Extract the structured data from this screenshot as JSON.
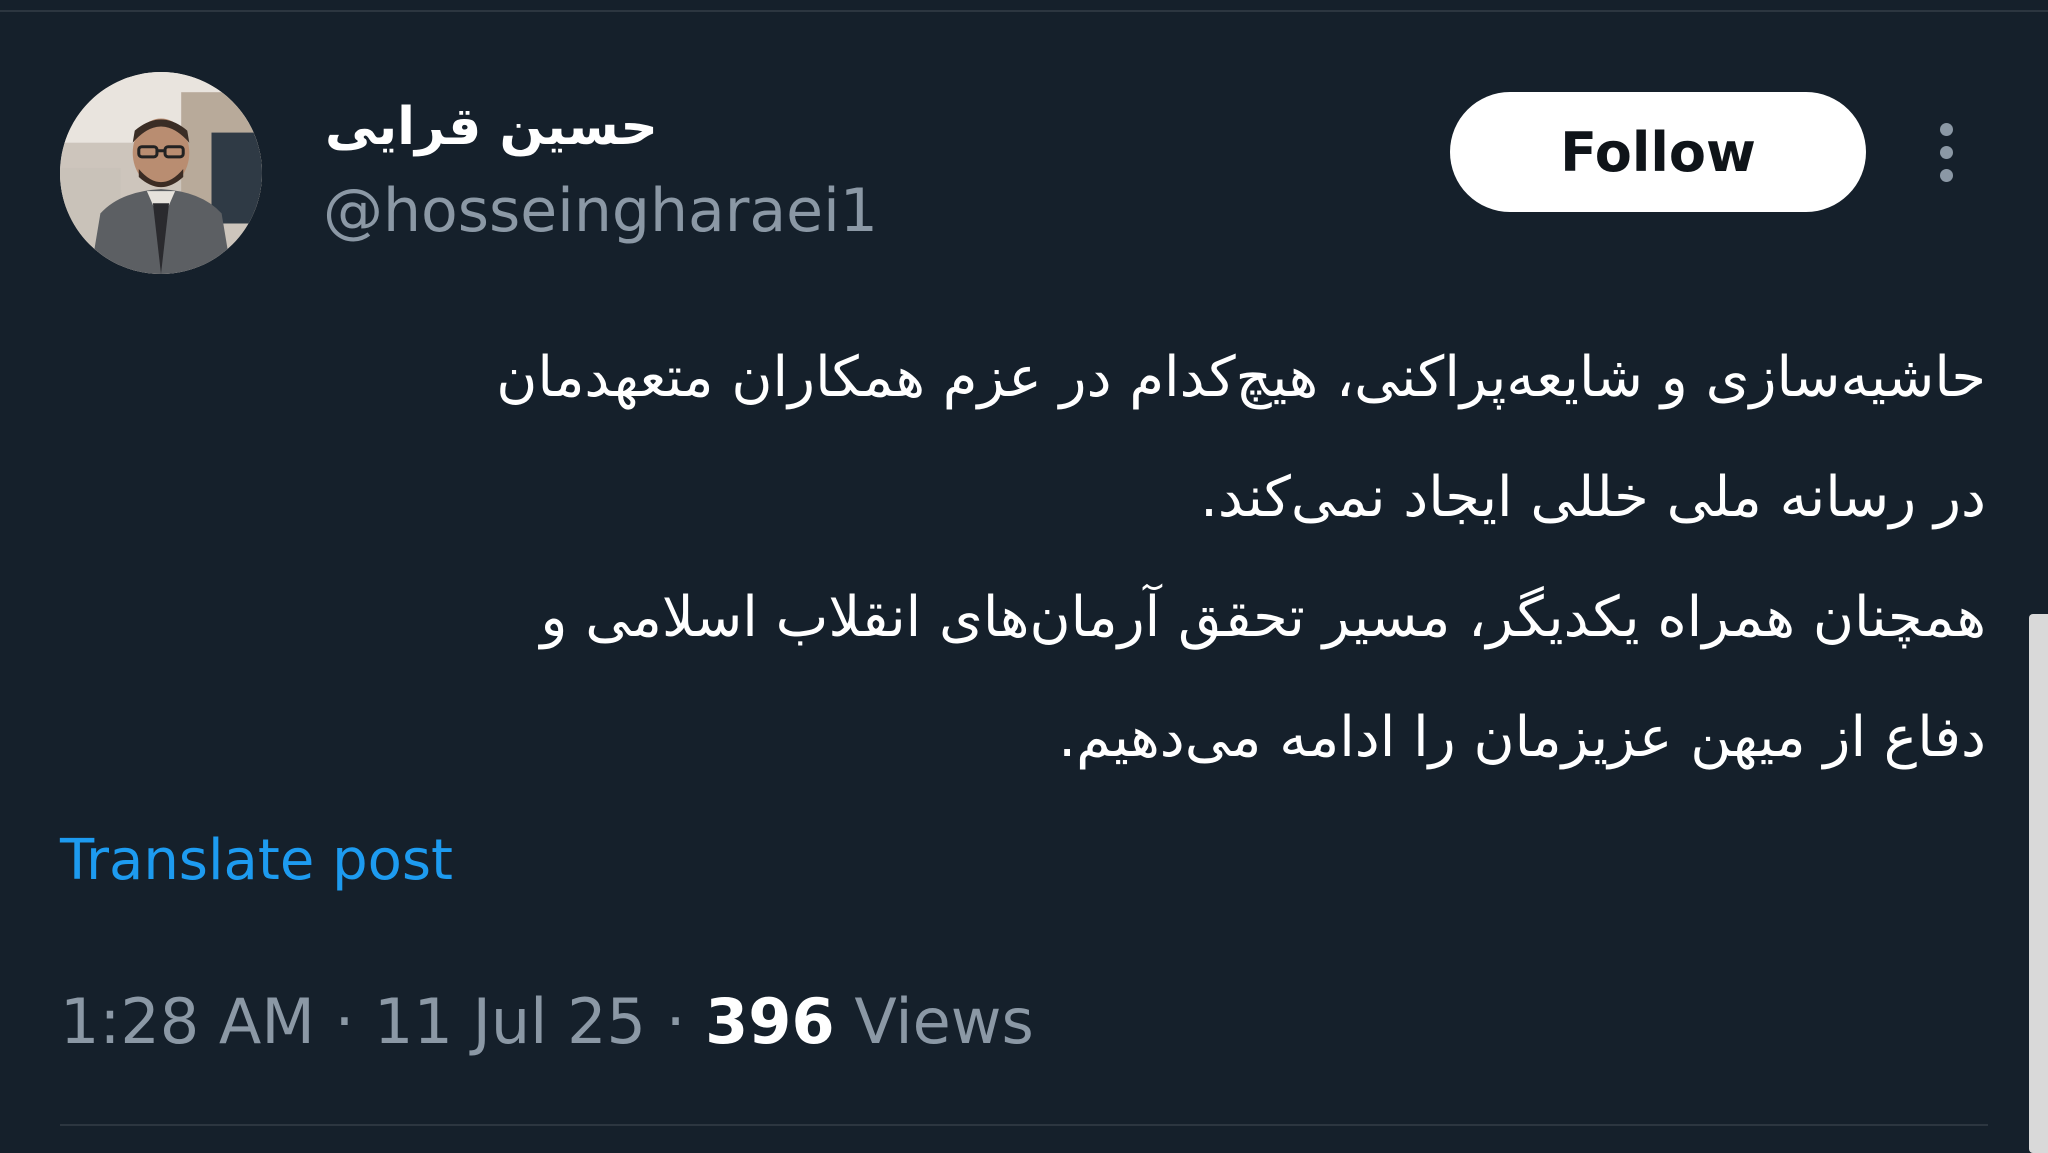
{
  "author": {
    "display_name": "حسین قرایی",
    "handle": "@hosseingharaei1"
  },
  "actions": {
    "follow_label": "Follow",
    "more_icon": "more-vertical-icon"
  },
  "tweet": {
    "lines": [
      "حاشیه‌سازی و شایعه‌پراکنی، هیچ‌کدام در عزم همکاران متعهدمان",
      "در رسانه ملی خللی ایجاد نمی‌کند.",
      "همچنان همراه یکدیگر، مسیر تحقق آرمان‌های انقلاب اسلامی و",
      "دفاع از میهن عزیزمان را ادامه می‌دهیم."
    ],
    "translate_label": "Translate post"
  },
  "meta": {
    "time": "1:28 AM",
    "separator": "·",
    "date": "11 Jul 25",
    "views_count": "396",
    "views_label": "Views"
  },
  "colors": {
    "background": "#15202b",
    "text_primary": "#ffffff",
    "text_secondary": "#8b98a5",
    "link": "#1d9bf0",
    "divider": "#2c3640"
  }
}
